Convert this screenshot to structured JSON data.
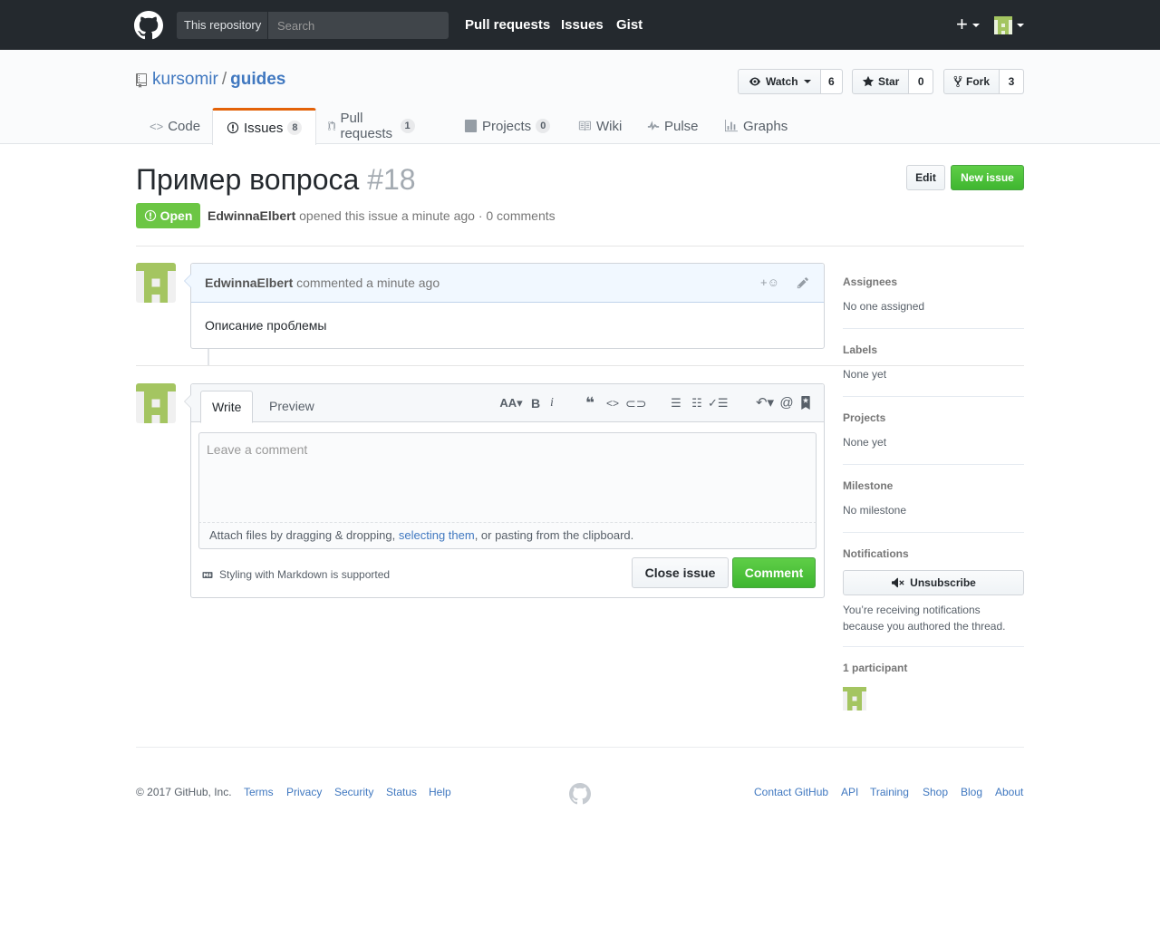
{
  "header": {
    "scope_label": "This repository",
    "search_placeholder": "Search",
    "nav": [
      "Pull requests",
      "Issues",
      "Gist"
    ],
    "new_icon": "plus-icon",
    "avatar_icon": "identicon-avatar"
  },
  "repo": {
    "owner": "kursomir",
    "separator": "/",
    "name": "guides",
    "watch": {
      "label": "Watch",
      "count": "6"
    },
    "star": {
      "label": "Star",
      "count": "0"
    },
    "fork": {
      "label": "Fork",
      "count": "3"
    }
  },
  "reponav": {
    "code": "Code",
    "issues": {
      "label": "Issues",
      "count": "8"
    },
    "pulls": {
      "label": "Pull requests",
      "count": "1"
    },
    "projects": {
      "label": "Projects",
      "count": "0"
    },
    "wiki": "Wiki",
    "pulse": "Pulse",
    "graphs": "Graphs"
  },
  "issue": {
    "title": "Пример вопроса",
    "number": "#18",
    "edit_label": "Edit",
    "new_issue_label": "New issue",
    "state": "Open",
    "author": "EdwinnaElbert",
    "meta_text": "opened this issue a minute ago · 0 comments"
  },
  "comment": {
    "author": "EdwinnaElbert",
    "meta": "commented a minute ago",
    "body": "Описание проблемы"
  },
  "composer": {
    "tab_write": "Write",
    "tab_preview": "Preview",
    "placeholder": "Leave a comment",
    "attach_prefix": "Attach files by dragging & dropping, ",
    "attach_link": "selecting them",
    "attach_suffix": ", or pasting from the clipboard.",
    "markdown_note": "Styling with Markdown is supported",
    "close_label": "Close issue",
    "comment_label": "Comment"
  },
  "sidebar": {
    "assignees": {
      "heading": "Assignees",
      "value": "No one assigned"
    },
    "labels": {
      "heading": "Labels",
      "value": "None yet"
    },
    "projects": {
      "heading": "Projects",
      "value": "None yet"
    },
    "milestone": {
      "heading": "Milestone",
      "value": "No milestone"
    },
    "notifications": {
      "heading": "Notifications",
      "button": "Unsubscribe",
      "line1": "You’re receiving notifications",
      "line2": "because you authored the thread."
    },
    "participants": "1 participant"
  },
  "footer": {
    "copyright": "© 2017 GitHub, Inc.",
    "left_links": [
      "Terms",
      "Privacy",
      "Security",
      "Status",
      "Help"
    ],
    "right_links": [
      "Contact GitHub",
      "API",
      "Training",
      "Shop",
      "Blog",
      "About"
    ]
  },
  "colors": {
    "header_bg": "#24292e",
    "link": "#4078c0",
    "open_green": "#6cc644",
    "tab_accent": "#e36209",
    "avatar_green": "#a4c561"
  }
}
